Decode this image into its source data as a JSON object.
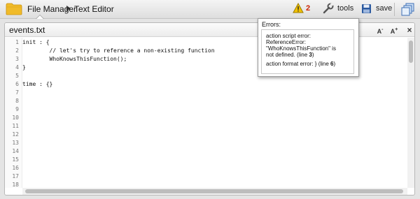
{
  "breadcrumb": {
    "root": "File Manager",
    "current": "Text Editor"
  },
  "toolbar": {
    "warnings_count": "2",
    "tools_label": "tools",
    "save_label": "save"
  },
  "editor": {
    "filename": "events.txt",
    "font_decrease": "A",
    "font_increase": "A",
    "close": "×",
    "line_numbers": [
      "1",
      "2",
      "3",
      "4",
      "5",
      "6",
      "7",
      "8",
      "9",
      "10",
      "11",
      "12",
      "13",
      "14",
      "15",
      "16",
      "17",
      "18"
    ],
    "lines": [
      "init : {",
      "        // let's try to reference a non-existing function",
      "        WhoKnowsThisFunction();",
      "}",
      "",
      "time : {}"
    ]
  },
  "errors_popup": {
    "title": "Errors:",
    "error1": {
      "l1": "action script error:",
      "l2": "ReferenceError:",
      "l3": "\"WhoKnowsThisFunction\" is",
      "l4": "not defined. (line ",
      "line": "3",
      "close": ")"
    },
    "error2": {
      "text": "action format error: } (line ",
      "line": "6",
      "close": ")"
    }
  },
  "colors": {
    "warning": "#f2c200",
    "error_count": "#cc2200",
    "folder": "#f0bb2a",
    "save": "#2c5aa0"
  }
}
